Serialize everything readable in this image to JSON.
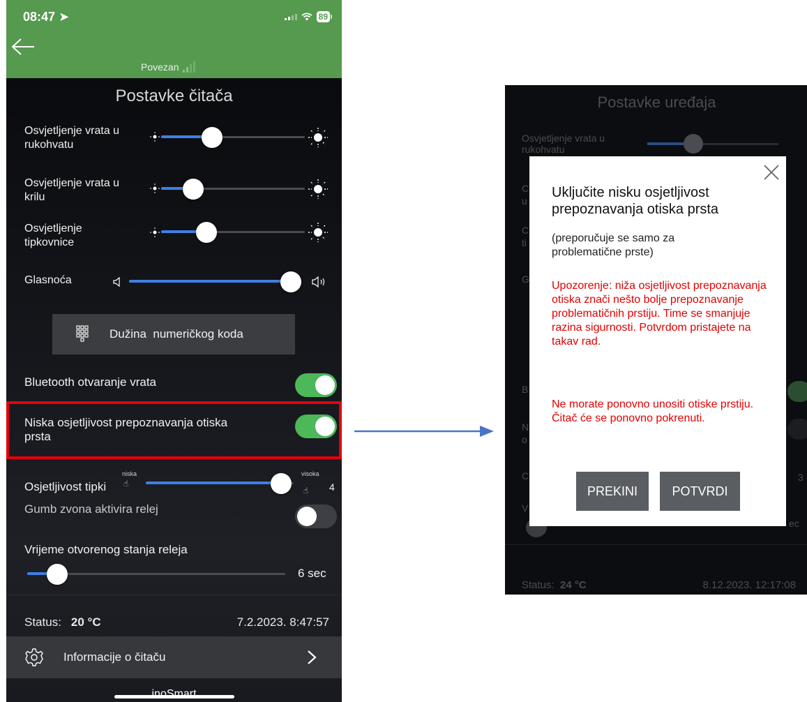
{
  "left_phone": {
    "status_bar": {
      "time": "08:47",
      "battery": "89"
    },
    "header": {
      "connection": "Povezan"
    },
    "title": "Postavke čitača",
    "settings": {
      "handle_light": {
        "label": "Osvjetljenje vrata u rukohvatu",
        "level": 0.34
      },
      "wing_light": {
        "label": "Osvjetljenje vrata u krilu",
        "level": 0.2
      },
      "keyboard_light": {
        "label": "Osvjetljenje tipkovnice",
        "level": 0.3
      },
      "volume": {
        "label": "Glasnoća",
        "level": 1.0
      }
    },
    "numeric_button": "Dužina  numeričkog koda",
    "bluetooth": {
      "label": "Bluetooth otvaranje vrata",
      "on": true
    },
    "low_sensitivity": {
      "label": "Niska osjetljivost prepoznavanja otiska prsta",
      "on": true
    },
    "key_sensitivity": {
      "label": "Osjetljivost tipki",
      "low": "niska",
      "high": "visoka",
      "value": "4",
      "level": 0.95
    },
    "doorbell_relay": {
      "label": "Gumb zvona aktivira relej",
      "on": false
    },
    "relay_time": {
      "label": "Vrijeme otvorenog stanja releja",
      "value": "6 sec",
      "level": 0.1
    },
    "status": {
      "label": "Status:",
      "temp": "20 °C",
      "datetime": "7.2.2023. 8:47:57"
    },
    "info": "Informacije o čitaču",
    "brand": "inoSmart"
  },
  "right_phone": {
    "title": "Postavke uređaja",
    "bg_label_1": "Osvjetljenje vrata u rukohvatu",
    "status": {
      "label": "Status:",
      "temp": "24 °C",
      "datetime": "8.12.2023. 12:17:08"
    },
    "bg_fragments": {
      "c1": "C",
      "u1": "u",
      "c2": "C",
      "t2": "ti",
      "g": "G",
      "b": "B",
      "n": "N",
      "o": "o",
      "c3": "C",
      "v": "V",
      "three": "3",
      "ec": "ec"
    },
    "modal": {
      "title": "Uključite nisku osjetljivost prepoznavanja otiska prsta",
      "subtitle": "(preporučuje se samo za problematične prste)",
      "warning": "Upozorenje: niža osjetljivost prepoznavanja otiska znači nešto bolje prepoznavanje problematičnih prstiju. Time se smanjuje razina sigurnosti. Potvrdom pristajete na takav rad.",
      "note": "Ne morate ponovno unositi otiske prstiju. Čitač će se ponovno pokrenuti.",
      "cancel": "PREKINI",
      "confirm": "POTVRDI"
    }
  },
  "colors": {
    "header_green": "#559a4f",
    "accent_blue": "#3f7fe6",
    "toggle_green": "#4db85a",
    "highlight_red": "#e3000f",
    "warning_red": "#e10000"
  }
}
